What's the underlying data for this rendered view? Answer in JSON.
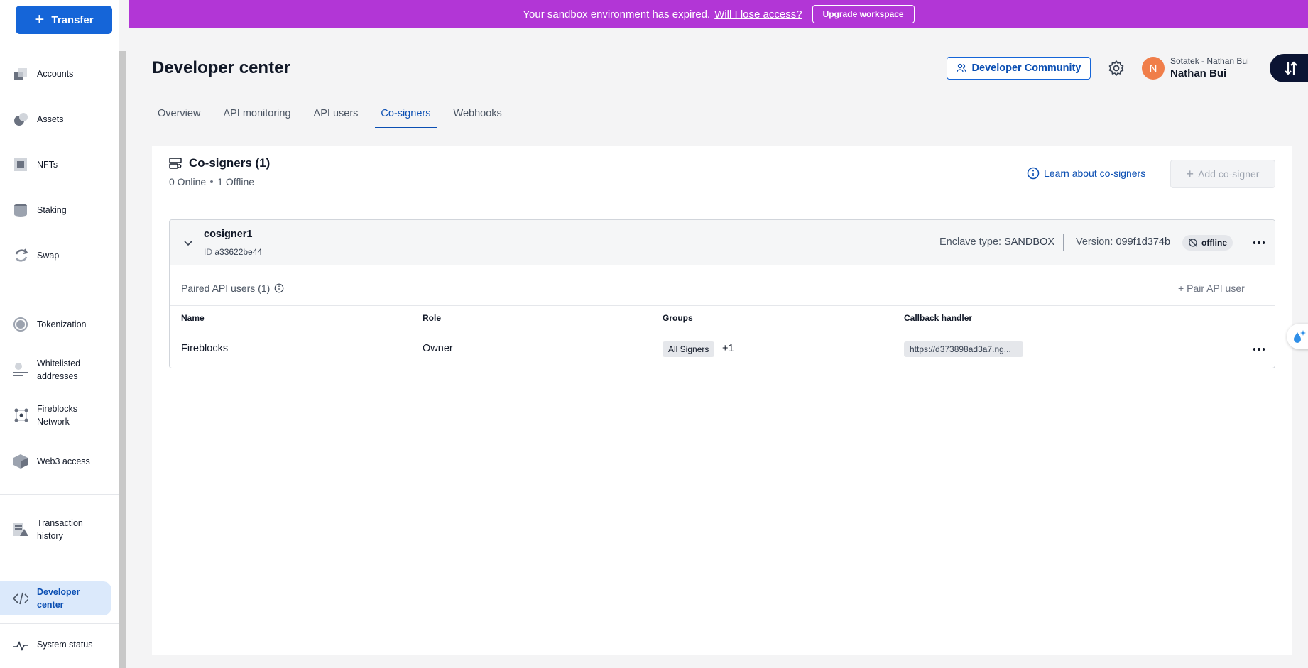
{
  "sidebar": {
    "transfer_label": "Transfer",
    "items": [
      {
        "label": "Accounts",
        "icon": "accounts-icon"
      },
      {
        "label": "Assets",
        "icon": "assets-icon"
      },
      {
        "label": "NFTs",
        "icon": "nfts-icon"
      },
      {
        "label": "Staking",
        "icon": "staking-icon"
      },
      {
        "label": "Swap",
        "icon": "swap-icon"
      },
      {
        "label": "Tokenization",
        "icon": "tokenization-icon"
      },
      {
        "label": "Whitelisted addresses",
        "icon": "whitelist-icon"
      },
      {
        "label": "Fireblocks Network",
        "icon": "network-icon"
      },
      {
        "label": "Web3 access",
        "icon": "web3-icon"
      },
      {
        "label": "Transaction history",
        "icon": "history-icon"
      },
      {
        "label": "Developer center",
        "icon": "code-icon",
        "active": true
      },
      {
        "label": "System status",
        "icon": "pulse-icon"
      }
    ]
  },
  "banner": {
    "message": "Your sandbox environment has expired.",
    "link": "Will I lose access?",
    "button": "Upgrade workspace",
    "color": "#b236d6"
  },
  "header": {
    "title": "Developer center",
    "community_button": "Developer Community",
    "user_org": "Sotatek - Nathan Bui",
    "user_name": "Nathan Bui",
    "avatar_initial": "N"
  },
  "tabs": [
    "Overview",
    "API monitoring",
    "API users",
    "Co-signers",
    "Webhooks"
  ],
  "active_tab": "Co-signers",
  "cosigners": {
    "title": "Co-signers (1)",
    "online": "0 Online",
    "offline": "1 Offline",
    "learn_link": "Learn about co-signers",
    "add_button": "Add co-signer",
    "item": {
      "name": "cosigner1",
      "id_label": "ID",
      "id": "a33622be44",
      "enclave_label": "Enclave type:",
      "enclave": "SANDBOX",
      "version_label": "Version:",
      "version": "099f1d374b",
      "status": "offline"
    },
    "paired_title": "Paired API users (1)",
    "pair_button": "Pair API user",
    "columns": [
      "Name",
      "Role",
      "Groups",
      "Callback handler"
    ],
    "rows": [
      {
        "name": "Fireblocks",
        "role": "Owner",
        "group": "All Signers",
        "group_more": "+1",
        "callback": "https://d373898ad3a7.ng..."
      }
    ]
  },
  "colors": {
    "accent": "#1565d8",
    "active_nav_bg": "#dbe9fb",
    "avatar": "#f07e4a"
  }
}
